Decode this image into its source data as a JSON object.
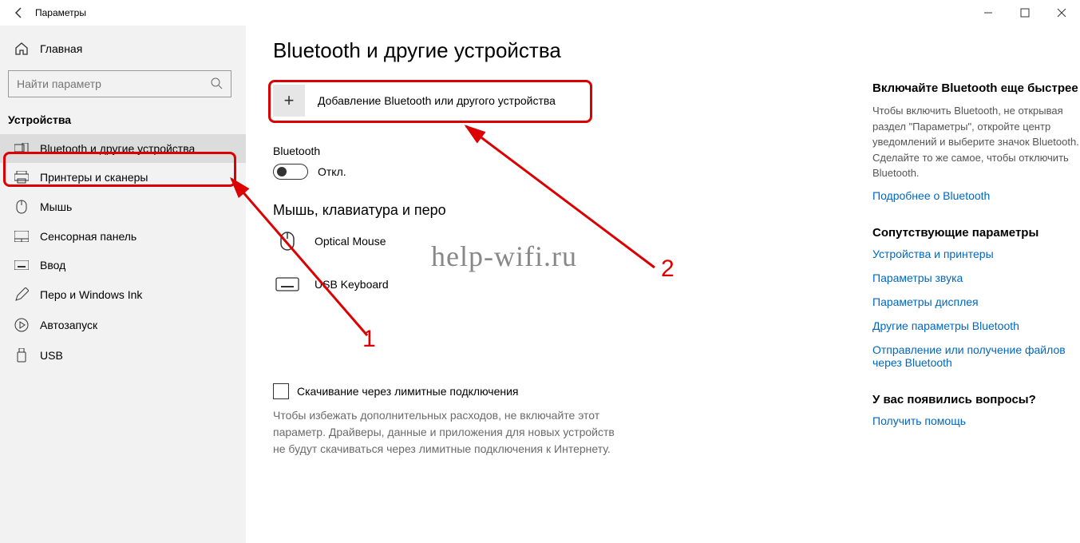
{
  "window": {
    "title": "Параметры"
  },
  "sidebar": {
    "home": "Главная",
    "search_placeholder": "Найти параметр",
    "section": "Устройства",
    "items": [
      {
        "label": "Bluetooth и другие устройства",
        "icon": "devices-icon",
        "selected": true
      },
      {
        "label": "Принтеры и сканеры",
        "icon": "printer-icon"
      },
      {
        "label": "Мышь",
        "icon": "mouse-icon"
      },
      {
        "label": "Сенсорная панель",
        "icon": "touchpad-icon"
      },
      {
        "label": "Ввод",
        "icon": "keyboard-icon"
      },
      {
        "label": "Перо и Windows Ink",
        "icon": "pen-icon"
      },
      {
        "label": "Автозапуск",
        "icon": "autoplay-icon"
      },
      {
        "label": "USB",
        "icon": "usb-icon"
      }
    ]
  },
  "main": {
    "title": "Bluetooth и другие устройства",
    "add_device": "Добавление Bluetooth или другого устройства",
    "bt_label": "Bluetooth",
    "bt_state": "Откл.",
    "subhead": "Мышь, клавиатура и перо",
    "devices": [
      {
        "name": "Optical Mouse",
        "icon": "mouse-device-icon"
      },
      {
        "name": "USB Keyboard",
        "icon": "keyboard-device-icon"
      }
    ],
    "metered_checkbox": "Скачивание через лимитные подключения",
    "metered_help": "Чтобы избежать дополнительных расходов, не включайте этот параметр. Драйверы, данные и приложения для новых устройств не будут скачиваться через лимитные подключения к Интернету."
  },
  "right": {
    "s1_head": "Включайте Bluetooth еще быстрее",
    "s1_text": "Чтобы включить Bluetooth, не открывая раздел \"Параметры\", откройте центр уведомлений и выберите значок Bluetooth. Сделайте то же самое, чтобы отключить Bluetooth.",
    "s1_link": "Подробнее о Bluetooth",
    "s2_head": "Сопутствующие параметры",
    "s2_links": [
      "Устройства и принтеры",
      "Параметры звука",
      "Параметры дисплея",
      "Другие параметры Bluetooth",
      "Отправление или получение файлов через Bluetooth"
    ],
    "s3_head": "У вас появились вопросы?",
    "s3_link": "Получить помощь"
  },
  "annotations": {
    "num1": "1",
    "num2": "2",
    "watermark": "help-wifi.ru"
  },
  "colors": {
    "accent_red": "#d00000",
    "link": "#0067c0"
  }
}
